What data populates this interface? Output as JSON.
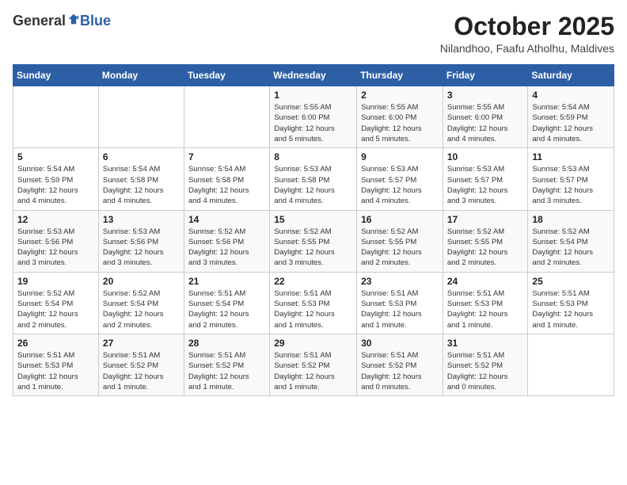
{
  "header": {
    "logo_general": "General",
    "logo_blue": "Blue",
    "month_title": "October 2025",
    "location": "Nilandhoo, Faafu Atholhu, Maldives"
  },
  "days_of_week": [
    "Sunday",
    "Monday",
    "Tuesday",
    "Wednesday",
    "Thursday",
    "Friday",
    "Saturday"
  ],
  "weeks": [
    [
      {
        "day": "",
        "info": ""
      },
      {
        "day": "",
        "info": ""
      },
      {
        "day": "",
        "info": ""
      },
      {
        "day": "1",
        "info": "Sunrise: 5:55 AM\nSunset: 6:00 PM\nDaylight: 12 hours\nand 5 minutes."
      },
      {
        "day": "2",
        "info": "Sunrise: 5:55 AM\nSunset: 6:00 PM\nDaylight: 12 hours\nand 5 minutes."
      },
      {
        "day": "3",
        "info": "Sunrise: 5:55 AM\nSunset: 6:00 PM\nDaylight: 12 hours\nand 4 minutes."
      },
      {
        "day": "4",
        "info": "Sunrise: 5:54 AM\nSunset: 5:59 PM\nDaylight: 12 hours\nand 4 minutes."
      }
    ],
    [
      {
        "day": "5",
        "info": "Sunrise: 5:54 AM\nSunset: 5:59 PM\nDaylight: 12 hours\nand 4 minutes."
      },
      {
        "day": "6",
        "info": "Sunrise: 5:54 AM\nSunset: 5:58 PM\nDaylight: 12 hours\nand 4 minutes."
      },
      {
        "day": "7",
        "info": "Sunrise: 5:54 AM\nSunset: 5:58 PM\nDaylight: 12 hours\nand 4 minutes."
      },
      {
        "day": "8",
        "info": "Sunrise: 5:53 AM\nSunset: 5:58 PM\nDaylight: 12 hours\nand 4 minutes."
      },
      {
        "day": "9",
        "info": "Sunrise: 5:53 AM\nSunset: 5:57 PM\nDaylight: 12 hours\nand 4 minutes."
      },
      {
        "day": "10",
        "info": "Sunrise: 5:53 AM\nSunset: 5:57 PM\nDaylight: 12 hours\nand 3 minutes."
      },
      {
        "day": "11",
        "info": "Sunrise: 5:53 AM\nSunset: 5:57 PM\nDaylight: 12 hours\nand 3 minutes."
      }
    ],
    [
      {
        "day": "12",
        "info": "Sunrise: 5:53 AM\nSunset: 5:56 PM\nDaylight: 12 hours\nand 3 minutes."
      },
      {
        "day": "13",
        "info": "Sunrise: 5:53 AM\nSunset: 5:56 PM\nDaylight: 12 hours\nand 3 minutes."
      },
      {
        "day": "14",
        "info": "Sunrise: 5:52 AM\nSunset: 5:56 PM\nDaylight: 12 hours\nand 3 minutes."
      },
      {
        "day": "15",
        "info": "Sunrise: 5:52 AM\nSunset: 5:55 PM\nDaylight: 12 hours\nand 3 minutes."
      },
      {
        "day": "16",
        "info": "Sunrise: 5:52 AM\nSunset: 5:55 PM\nDaylight: 12 hours\nand 2 minutes."
      },
      {
        "day": "17",
        "info": "Sunrise: 5:52 AM\nSunset: 5:55 PM\nDaylight: 12 hours\nand 2 minutes."
      },
      {
        "day": "18",
        "info": "Sunrise: 5:52 AM\nSunset: 5:54 PM\nDaylight: 12 hours\nand 2 minutes."
      }
    ],
    [
      {
        "day": "19",
        "info": "Sunrise: 5:52 AM\nSunset: 5:54 PM\nDaylight: 12 hours\nand 2 minutes."
      },
      {
        "day": "20",
        "info": "Sunrise: 5:52 AM\nSunset: 5:54 PM\nDaylight: 12 hours\nand 2 minutes."
      },
      {
        "day": "21",
        "info": "Sunrise: 5:51 AM\nSunset: 5:54 PM\nDaylight: 12 hours\nand 2 minutes."
      },
      {
        "day": "22",
        "info": "Sunrise: 5:51 AM\nSunset: 5:53 PM\nDaylight: 12 hours\nand 1 minutes."
      },
      {
        "day": "23",
        "info": "Sunrise: 5:51 AM\nSunset: 5:53 PM\nDaylight: 12 hours\nand 1 minute."
      },
      {
        "day": "24",
        "info": "Sunrise: 5:51 AM\nSunset: 5:53 PM\nDaylight: 12 hours\nand 1 minute."
      },
      {
        "day": "25",
        "info": "Sunrise: 5:51 AM\nSunset: 5:53 PM\nDaylight: 12 hours\nand 1 minute."
      }
    ],
    [
      {
        "day": "26",
        "info": "Sunrise: 5:51 AM\nSunset: 5:53 PM\nDaylight: 12 hours\nand 1 minute."
      },
      {
        "day": "27",
        "info": "Sunrise: 5:51 AM\nSunset: 5:52 PM\nDaylight: 12 hours\nand 1 minute."
      },
      {
        "day": "28",
        "info": "Sunrise: 5:51 AM\nSunset: 5:52 PM\nDaylight: 12 hours\nand 1 minute."
      },
      {
        "day": "29",
        "info": "Sunrise: 5:51 AM\nSunset: 5:52 PM\nDaylight: 12 hours\nand 1 minute."
      },
      {
        "day": "30",
        "info": "Sunrise: 5:51 AM\nSunset: 5:52 PM\nDaylight: 12 hours\nand 0 minutes."
      },
      {
        "day": "31",
        "info": "Sunrise: 5:51 AM\nSunset: 5:52 PM\nDaylight: 12 hours\nand 0 minutes."
      },
      {
        "day": "",
        "info": ""
      }
    ]
  ]
}
